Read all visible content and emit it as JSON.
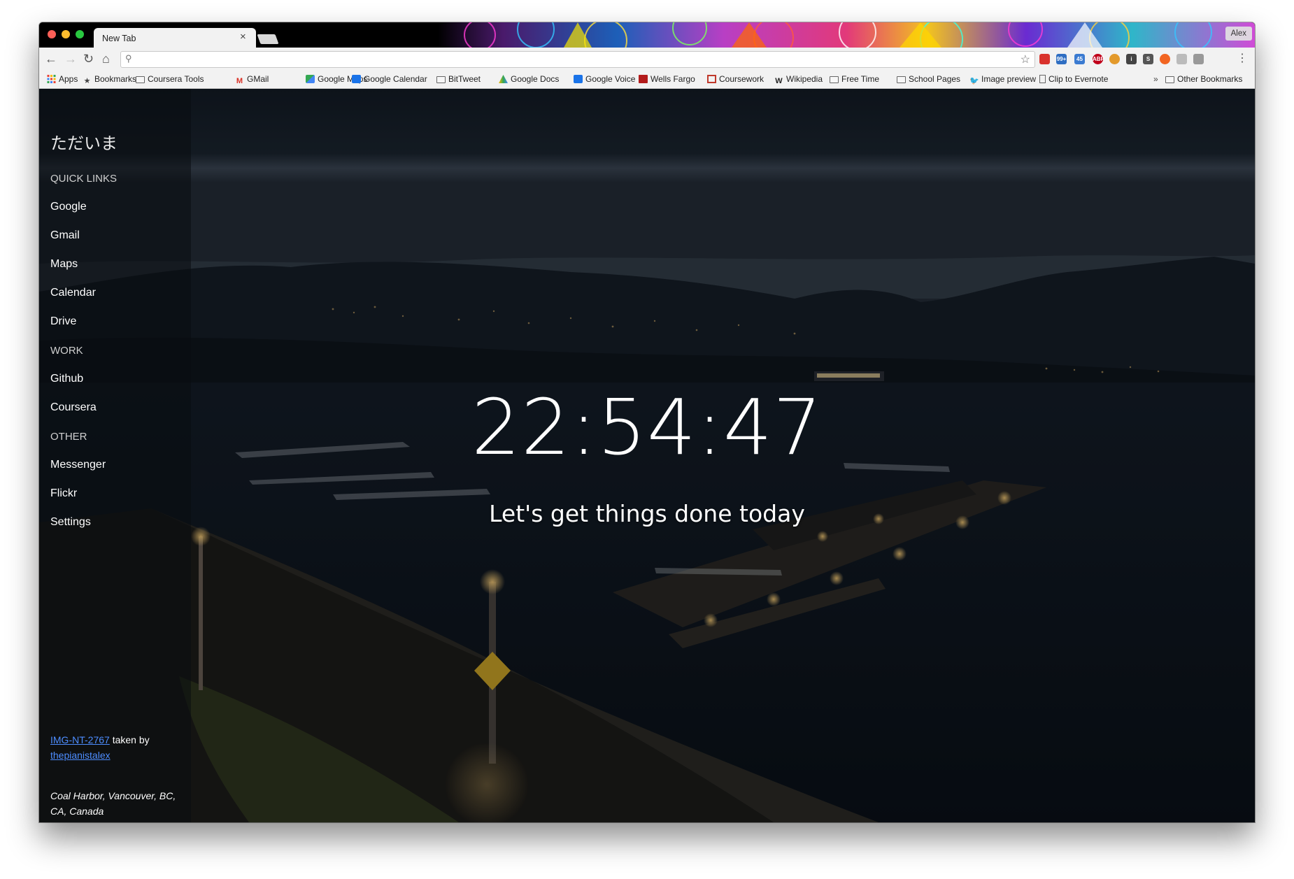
{
  "tab": {
    "title": "New Tab",
    "close": "×"
  },
  "profile": {
    "name": "Alex"
  },
  "toolbar": {
    "back": "←",
    "forward": "→",
    "reload": "↻",
    "home": "⌂",
    "search_icon": "⚲",
    "star_icon": "☆",
    "menu_icon": "⋮"
  },
  "extensions": [
    {
      "name": "bookmark-ext-icon",
      "label": "",
      "color": "#d9322c"
    },
    {
      "name": "mail-count-icon",
      "label": "99+",
      "color": "#2f6ec2"
    },
    {
      "name": "calendar-count-icon",
      "label": "45",
      "color": "#3b7bd1"
    },
    {
      "name": "adblock-icon",
      "label": "ABP",
      "color": "#c0001a"
    },
    {
      "name": "cookie-icon",
      "label": "",
      "color": "#e39a2c"
    },
    {
      "name": "info-icon",
      "label": "i",
      "color": "#444444"
    },
    {
      "name": "s-ext-icon",
      "label": "S",
      "color": "#555555"
    },
    {
      "name": "orange-ext-icon",
      "label": "",
      "color": "#f26522"
    },
    {
      "name": "grey-ext-icon",
      "label": "",
      "color": "#bbbbbb"
    },
    {
      "name": "square-ext-icon",
      "label": "",
      "color": "#999999"
    }
  ],
  "bookmarks": {
    "apps": "Apps",
    "items": [
      "Bookmarks",
      "Coursera Tools",
      "GMail",
      "Google Maps",
      "Google Calendar",
      "BitTweet",
      "Google Docs",
      "Google Voice",
      "Wells Fargo",
      "Coursework",
      "Wikipedia",
      "Free Time",
      "School Pages",
      "Image preview",
      "Clip to Evernote"
    ],
    "overflow": "»",
    "other": "Other Bookmarks"
  },
  "sidebar": {
    "greeting": "ただいま",
    "quick_links_heading": "QUICK LINKS",
    "quick_links": [
      "Google",
      "Gmail",
      "Maps",
      "Calendar",
      "Drive"
    ],
    "work_heading": "WORK",
    "work": [
      "Github",
      "Coursera"
    ],
    "other_heading": "OTHER",
    "other": [
      "Messenger",
      "Flickr",
      "Settings"
    ]
  },
  "credit": {
    "image_link": "IMG-NT-2767",
    "taken_by": "taken by",
    "author_link": "thepianistalex",
    "location": "Coal Harbor, Vancouver, BC, CA, Canada"
  },
  "clock": "22:54:47",
  "tagline": "Let's get things done today"
}
